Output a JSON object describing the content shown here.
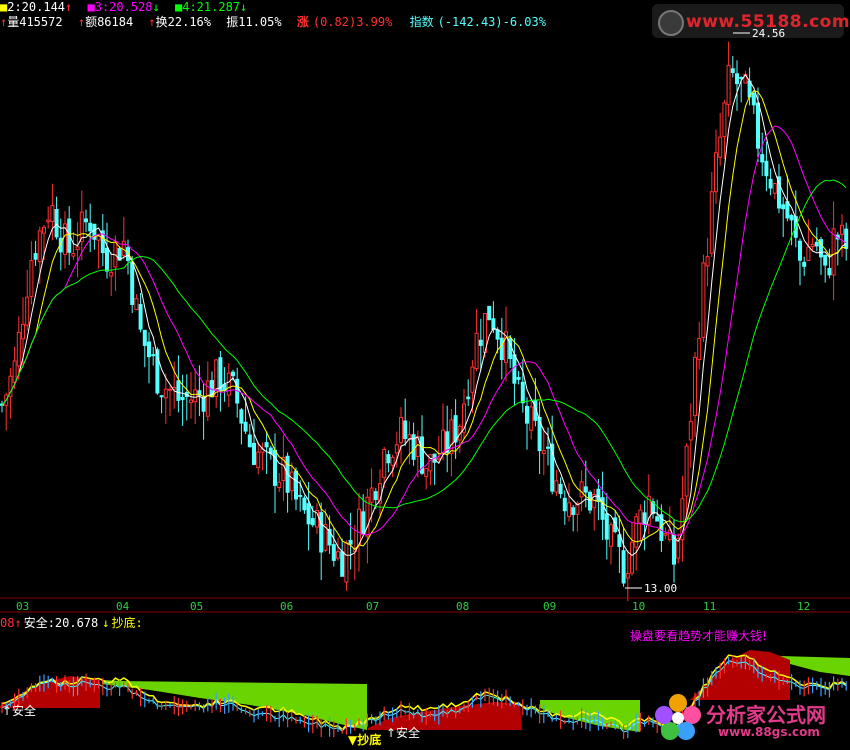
{
  "header": {
    "ma_row": [
      {
        "label": "2:20.144",
        "color": "#ffffff",
        "arrow": "↑",
        "arrow_color": "#ff3030",
        "sq": "#ffff00"
      },
      {
        "label": "3:20.528",
        "color": "#ff00ff",
        "arrow": "↓",
        "arrow_color": "#00ff00",
        "sq": "#ff00ff"
      },
      {
        "label": "4:21.287",
        "color": "#00ff00",
        "arrow": "↓",
        "arrow_color": "#00ff00",
        "sq": "#00ff00"
      }
    ],
    "stats": [
      {
        "arrow": "↑",
        "text": "量415572"
      },
      {
        "arrow": "↑",
        "text": "额86184"
      },
      {
        "arrow": "↑",
        "text": "换22.16%"
      },
      {
        "arrow": "",
        "text": "振11.05%"
      }
    ],
    "zhang_label": "涨",
    "zhang_value": "(0.82)3.99%",
    "index_label": "指数",
    "index_value": "(-142.43)-6.03%"
  },
  "price_annotations": {
    "high": "24.56",
    "low": "13.00"
  },
  "x_axis_labels": [
    "03",
    "04",
    "05",
    "06",
    "07",
    "08",
    "09",
    "10",
    "11",
    "12"
  ],
  "indicator": {
    "prefix": "08",
    "safe_label": "安全:20.678",
    "bottom_label": "抄底:",
    "slogan": "操盘要看趋势才能赚大钱!",
    "marker_safe": "安全",
    "marker_bottom": "抄底"
  },
  "watermarks": {
    "top": "www.55188.com",
    "bottom_cn": "分析家公式网",
    "bottom_url": "www.88gs.com"
  },
  "colors": {
    "up": "#ff3030",
    "down": "#54ffff",
    "ma5": "#ffffff",
    "ma10": "#ffff00",
    "ma20": "#ff00ff",
    "ma40": "#00ff00"
  },
  "chart_data": {
    "type": "candlestick",
    "x_label_months": [
      "03",
      "04",
      "05",
      "06",
      "07",
      "08",
      "09",
      "10",
      "11",
      "12"
    ],
    "price_high": 24.56,
    "price_low": 13.0,
    "series": [
      {
        "name": "2",
        "last": 20.144
      },
      {
        "name": "3",
        "last": 20.528
      },
      {
        "name": "4",
        "last": 21.287
      }
    ]
  }
}
